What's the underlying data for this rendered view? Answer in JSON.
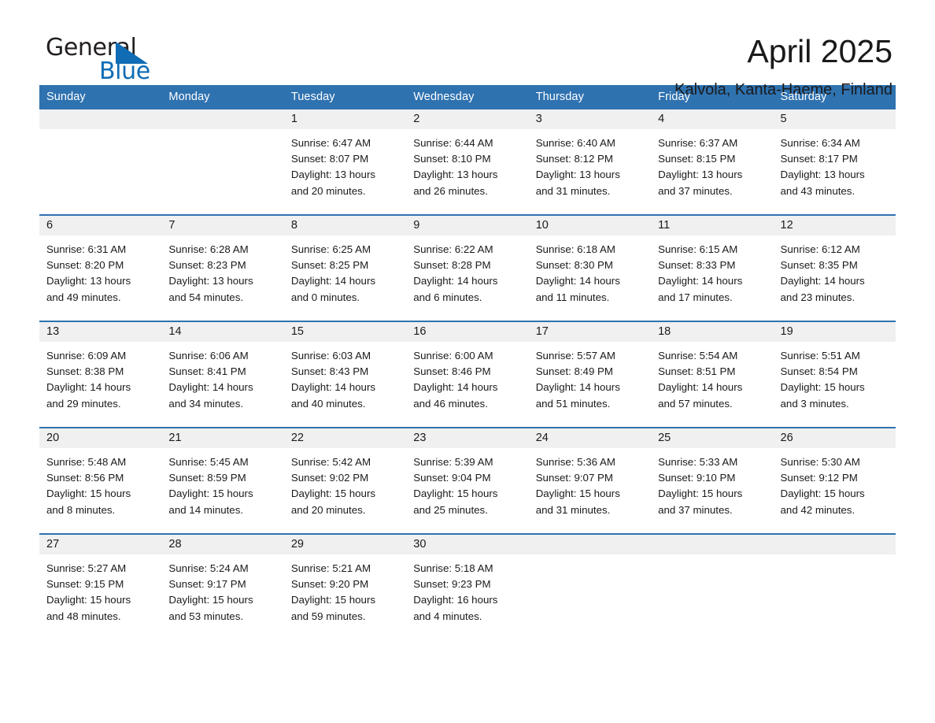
{
  "brand": {
    "name_part1": "General",
    "name_part2": "Blue",
    "triangle_color": "#0f6cb5"
  },
  "header": {
    "title": "April 2025",
    "location": "Kalvola, Kanta-Haeme, Finland",
    "accent_color": "#2f72b0",
    "daynum_band_color": "#f0f0f0"
  },
  "weekday_headers": [
    "Sunday",
    "Monday",
    "Tuesday",
    "Wednesday",
    "Thursday",
    "Friday",
    "Saturday"
  ],
  "weeks": [
    [
      {
        "day": "",
        "sunrise": "",
        "sunset": "",
        "daylight_1": "",
        "daylight_2": ""
      },
      {
        "day": "",
        "sunrise": "",
        "sunset": "",
        "daylight_1": "",
        "daylight_2": ""
      },
      {
        "day": "1",
        "sunrise": "Sunrise: 6:47 AM",
        "sunset": "Sunset: 8:07 PM",
        "daylight_1": "Daylight: 13 hours",
        "daylight_2": "and 20 minutes."
      },
      {
        "day": "2",
        "sunrise": "Sunrise: 6:44 AM",
        "sunset": "Sunset: 8:10 PM",
        "daylight_1": "Daylight: 13 hours",
        "daylight_2": "and 26 minutes."
      },
      {
        "day": "3",
        "sunrise": "Sunrise: 6:40 AM",
        "sunset": "Sunset: 8:12 PM",
        "daylight_1": "Daylight: 13 hours",
        "daylight_2": "and 31 minutes."
      },
      {
        "day": "4",
        "sunrise": "Sunrise: 6:37 AM",
        "sunset": "Sunset: 8:15 PM",
        "daylight_1": "Daylight: 13 hours",
        "daylight_2": "and 37 minutes."
      },
      {
        "day": "5",
        "sunrise": "Sunrise: 6:34 AM",
        "sunset": "Sunset: 8:17 PM",
        "daylight_1": "Daylight: 13 hours",
        "daylight_2": "and 43 minutes."
      }
    ],
    [
      {
        "day": "6",
        "sunrise": "Sunrise: 6:31 AM",
        "sunset": "Sunset: 8:20 PM",
        "daylight_1": "Daylight: 13 hours",
        "daylight_2": "and 49 minutes."
      },
      {
        "day": "7",
        "sunrise": "Sunrise: 6:28 AM",
        "sunset": "Sunset: 8:23 PM",
        "daylight_1": "Daylight: 13 hours",
        "daylight_2": "and 54 minutes."
      },
      {
        "day": "8",
        "sunrise": "Sunrise: 6:25 AM",
        "sunset": "Sunset: 8:25 PM",
        "daylight_1": "Daylight: 14 hours",
        "daylight_2": "and 0 minutes."
      },
      {
        "day": "9",
        "sunrise": "Sunrise: 6:22 AM",
        "sunset": "Sunset: 8:28 PM",
        "daylight_1": "Daylight: 14 hours",
        "daylight_2": "and 6 minutes."
      },
      {
        "day": "10",
        "sunrise": "Sunrise: 6:18 AM",
        "sunset": "Sunset: 8:30 PM",
        "daylight_1": "Daylight: 14 hours",
        "daylight_2": "and 11 minutes."
      },
      {
        "day": "11",
        "sunrise": "Sunrise: 6:15 AM",
        "sunset": "Sunset: 8:33 PM",
        "daylight_1": "Daylight: 14 hours",
        "daylight_2": "and 17 minutes."
      },
      {
        "day": "12",
        "sunrise": "Sunrise: 6:12 AM",
        "sunset": "Sunset: 8:35 PM",
        "daylight_1": "Daylight: 14 hours",
        "daylight_2": "and 23 minutes."
      }
    ],
    [
      {
        "day": "13",
        "sunrise": "Sunrise: 6:09 AM",
        "sunset": "Sunset: 8:38 PM",
        "daylight_1": "Daylight: 14 hours",
        "daylight_2": "and 29 minutes."
      },
      {
        "day": "14",
        "sunrise": "Sunrise: 6:06 AM",
        "sunset": "Sunset: 8:41 PM",
        "daylight_1": "Daylight: 14 hours",
        "daylight_2": "and 34 minutes."
      },
      {
        "day": "15",
        "sunrise": "Sunrise: 6:03 AM",
        "sunset": "Sunset: 8:43 PM",
        "daylight_1": "Daylight: 14 hours",
        "daylight_2": "and 40 minutes."
      },
      {
        "day": "16",
        "sunrise": "Sunrise: 6:00 AM",
        "sunset": "Sunset: 8:46 PM",
        "daylight_1": "Daylight: 14 hours",
        "daylight_2": "and 46 minutes."
      },
      {
        "day": "17",
        "sunrise": "Sunrise: 5:57 AM",
        "sunset": "Sunset: 8:49 PM",
        "daylight_1": "Daylight: 14 hours",
        "daylight_2": "and 51 minutes."
      },
      {
        "day": "18",
        "sunrise": "Sunrise: 5:54 AM",
        "sunset": "Sunset: 8:51 PM",
        "daylight_1": "Daylight: 14 hours",
        "daylight_2": "and 57 minutes."
      },
      {
        "day": "19",
        "sunrise": "Sunrise: 5:51 AM",
        "sunset": "Sunset: 8:54 PM",
        "daylight_1": "Daylight: 15 hours",
        "daylight_2": "and 3 minutes."
      }
    ],
    [
      {
        "day": "20",
        "sunrise": "Sunrise: 5:48 AM",
        "sunset": "Sunset: 8:56 PM",
        "daylight_1": "Daylight: 15 hours",
        "daylight_2": "and 8 minutes."
      },
      {
        "day": "21",
        "sunrise": "Sunrise: 5:45 AM",
        "sunset": "Sunset: 8:59 PM",
        "daylight_1": "Daylight: 15 hours",
        "daylight_2": "and 14 minutes."
      },
      {
        "day": "22",
        "sunrise": "Sunrise: 5:42 AM",
        "sunset": "Sunset: 9:02 PM",
        "daylight_1": "Daylight: 15 hours",
        "daylight_2": "and 20 minutes."
      },
      {
        "day": "23",
        "sunrise": "Sunrise: 5:39 AM",
        "sunset": "Sunset: 9:04 PM",
        "daylight_1": "Daylight: 15 hours",
        "daylight_2": "and 25 minutes."
      },
      {
        "day": "24",
        "sunrise": "Sunrise: 5:36 AM",
        "sunset": "Sunset: 9:07 PM",
        "daylight_1": "Daylight: 15 hours",
        "daylight_2": "and 31 minutes."
      },
      {
        "day": "25",
        "sunrise": "Sunrise: 5:33 AM",
        "sunset": "Sunset: 9:10 PM",
        "daylight_1": "Daylight: 15 hours",
        "daylight_2": "and 37 minutes."
      },
      {
        "day": "26",
        "sunrise": "Sunrise: 5:30 AM",
        "sunset": "Sunset: 9:12 PM",
        "daylight_1": "Daylight: 15 hours",
        "daylight_2": "and 42 minutes."
      }
    ],
    [
      {
        "day": "27",
        "sunrise": "Sunrise: 5:27 AM",
        "sunset": "Sunset: 9:15 PM",
        "daylight_1": "Daylight: 15 hours",
        "daylight_2": "and 48 minutes."
      },
      {
        "day": "28",
        "sunrise": "Sunrise: 5:24 AM",
        "sunset": "Sunset: 9:17 PM",
        "daylight_1": "Daylight: 15 hours",
        "daylight_2": "and 53 minutes."
      },
      {
        "day": "29",
        "sunrise": "Sunrise: 5:21 AM",
        "sunset": "Sunset: 9:20 PM",
        "daylight_1": "Daylight: 15 hours",
        "daylight_2": "and 59 minutes."
      },
      {
        "day": "30",
        "sunrise": "Sunrise: 5:18 AM",
        "sunset": "Sunset: 9:23 PM",
        "daylight_1": "Daylight: 16 hours",
        "daylight_2": "and 4 minutes."
      },
      {
        "day": "",
        "sunrise": "",
        "sunset": "",
        "daylight_1": "",
        "daylight_2": ""
      },
      {
        "day": "",
        "sunrise": "",
        "sunset": "",
        "daylight_1": "",
        "daylight_2": ""
      },
      {
        "day": "",
        "sunrise": "",
        "sunset": "",
        "daylight_1": "",
        "daylight_2": ""
      }
    ]
  ]
}
